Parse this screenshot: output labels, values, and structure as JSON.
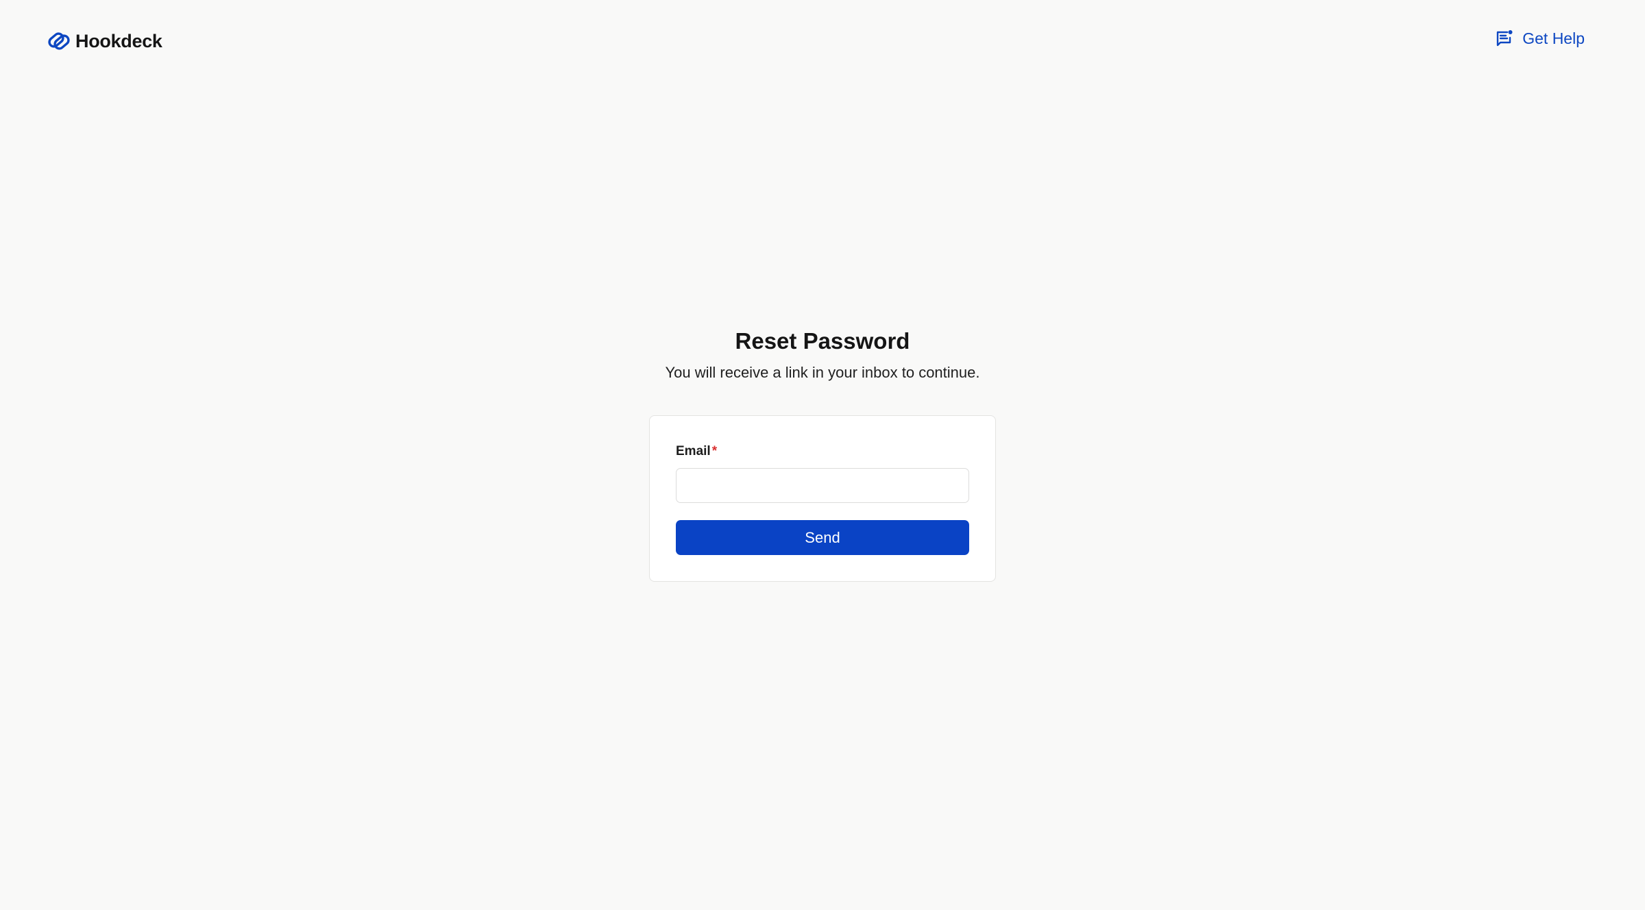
{
  "header": {
    "brand_name": "Hookdeck",
    "logo_icon": "hookdeck-link-icon",
    "help_icon": "chat-message-icon",
    "help_label": "Get Help"
  },
  "main": {
    "title": "Reset Password",
    "subtitle": "You will receive a link in your inbox to continue."
  },
  "form": {
    "email_label": "Email",
    "required_marker": "*",
    "email_value": "",
    "send_label": "Send"
  },
  "colors": {
    "accent": "#0a43c5",
    "link": "#0d47c2",
    "required": "#d93030",
    "background": "#f9f9f8"
  }
}
